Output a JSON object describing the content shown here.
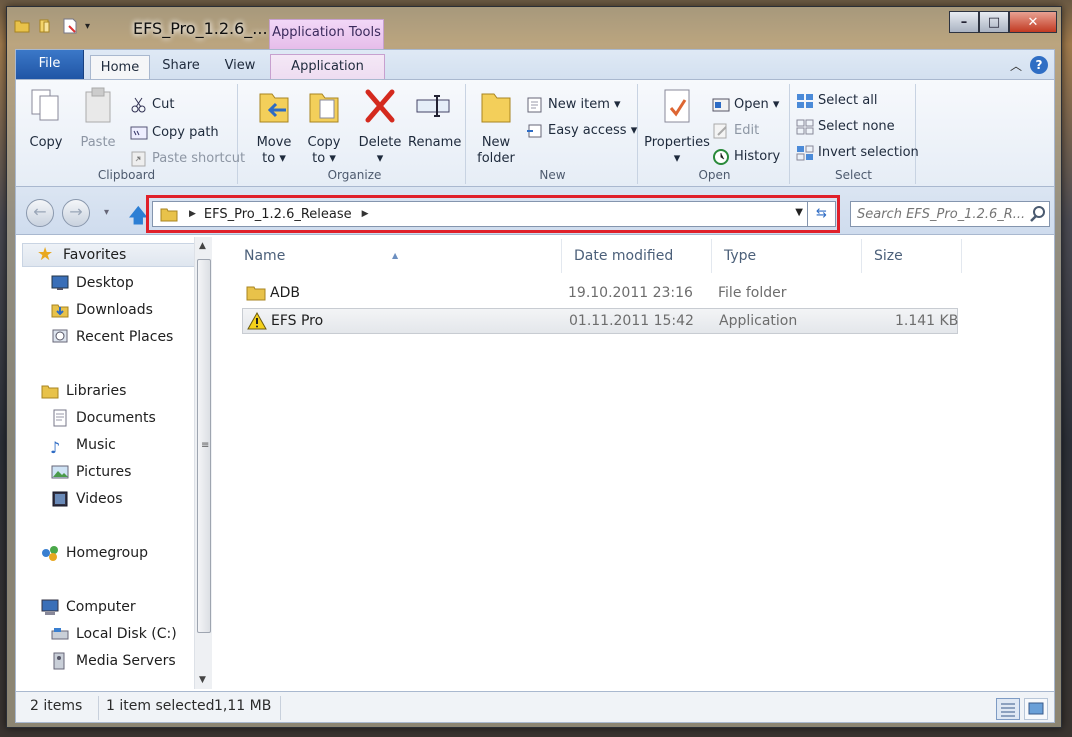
{
  "window": {
    "title": "EFS_Pro_1.2.6_...",
    "contextual_tab_title": "Application Tools",
    "buttons": {
      "minimize": "–",
      "maximize": "□",
      "close": "✕"
    }
  },
  "ribbon": {
    "tabs": [
      "File",
      "Home",
      "Share",
      "View",
      "Application"
    ],
    "active_tab": "Home",
    "clipboard": {
      "label": "Clipboard",
      "copy": "Copy",
      "paste": "Paste",
      "cut": "Cut",
      "copy_path": "Copy path",
      "paste_shortcut": "Paste shortcut"
    },
    "organize": {
      "label": "Organize",
      "move_to": "Move",
      "move_to2": "to ▾",
      "copy_to": "Copy",
      "copy_to2": "to ▾",
      "delete": "Delete",
      "delete_caret": "▾",
      "rename": "Rename"
    },
    "new": {
      "label": "New",
      "new_folder": "New",
      "new_folder2": "folder",
      "new_item": "New item ▾",
      "easy_access": "Easy access ▾"
    },
    "open": {
      "label": "Open",
      "properties": "Properties",
      "properties_caret": "▾",
      "open": "Open ▾",
      "edit": "Edit",
      "history": "History"
    },
    "select": {
      "label": "Select",
      "select_all": "Select all",
      "select_none": "Select none",
      "invert_selection": "Invert selection"
    }
  },
  "address": {
    "crumb": "EFS_Pro_1.2.6_Release",
    "search_placeholder": "Search EFS_Pro_1.2.6_R..."
  },
  "navpane": {
    "favorites": "Favorites",
    "desktop": "Desktop",
    "downloads": "Downloads",
    "recent_places": "Recent Places",
    "libraries": "Libraries",
    "documents": "Documents",
    "music": "Music",
    "pictures": "Pictures",
    "videos": "Videos",
    "homegroup": "Homegroup",
    "computer": "Computer",
    "local_disk": "Local Disk (C:)",
    "media_servers": "Media Servers"
  },
  "filelist": {
    "columns": {
      "name": "Name",
      "date": "Date modified",
      "type": "Type",
      "size": "Size"
    },
    "rows": [
      {
        "name": "ADB",
        "date": "19.10.2011 23:16",
        "type": "File folder",
        "size": ""
      },
      {
        "name": "EFS Pro",
        "date": "01.11.2011 15:42",
        "type": "Application",
        "size": "1.141 KB"
      }
    ]
  },
  "status": {
    "items": "2 items",
    "selected": "1 item selected",
    "selected_size": "1,11 MB"
  },
  "colors": {
    "file_tab": "#2b64b4",
    "contextual_tab": "#e6bdea",
    "highlight_box": "#e0202a"
  }
}
